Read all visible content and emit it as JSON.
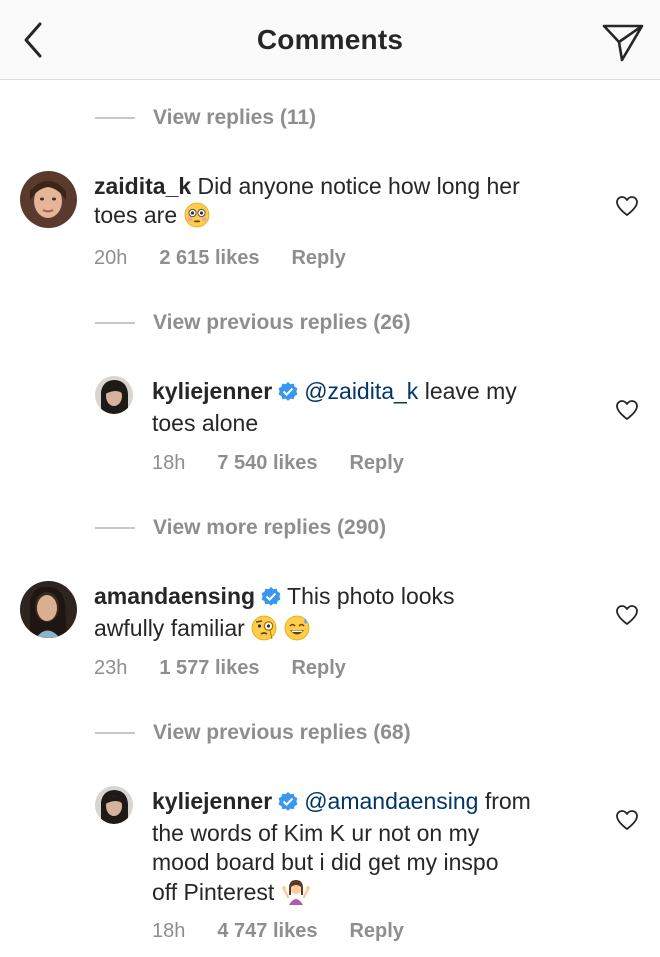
{
  "header": {
    "title": "Comments"
  },
  "view_replies": [
    {
      "label": "View replies (11)"
    },
    {
      "label": "View previous replies (26)"
    },
    {
      "label": "View more replies (290)"
    },
    {
      "label": "View previous replies (68)"
    }
  ],
  "comments": [
    {
      "username": "zaidita_k",
      "text": "Did anyone notice how long her",
      "text2": "toes are",
      "time": "20h",
      "likes": "2 615 likes",
      "reply": "Reply"
    },
    {
      "username": "kyliejenner",
      "mention": "@zaidita_k",
      "text": "leave my",
      "text2": "toes alone",
      "time": "18h",
      "likes": "7 540 likes",
      "reply": "Reply"
    },
    {
      "username": "amandaensing",
      "text": "This photo looks",
      "text2": "awfully familiar",
      "time": "23h",
      "likes": "1 577 likes",
      "reply": "Reply"
    },
    {
      "username": "kyliejenner",
      "mention": "@amandaensing",
      "text": "from",
      "text2": "the words of Kim K ur not on my",
      "text3": "mood board but i did get my inspo",
      "text4": "off Pinterest",
      "time": "18h",
      "likes": "4 747 likes",
      "reply": "Reply"
    }
  ],
  "colors": {
    "verified": "#3897f0",
    "mention": "#003569",
    "meta": "#8e8e8e"
  },
  "icons": [
    "back-chevron-icon",
    "direct-send-icon",
    "heart-icon",
    "verified-badge-icon",
    "flushed-face-emoji",
    "face-with-monocle-emoji",
    "grinning-sweat-emoji",
    "shrugging-woman-emoji"
  ]
}
